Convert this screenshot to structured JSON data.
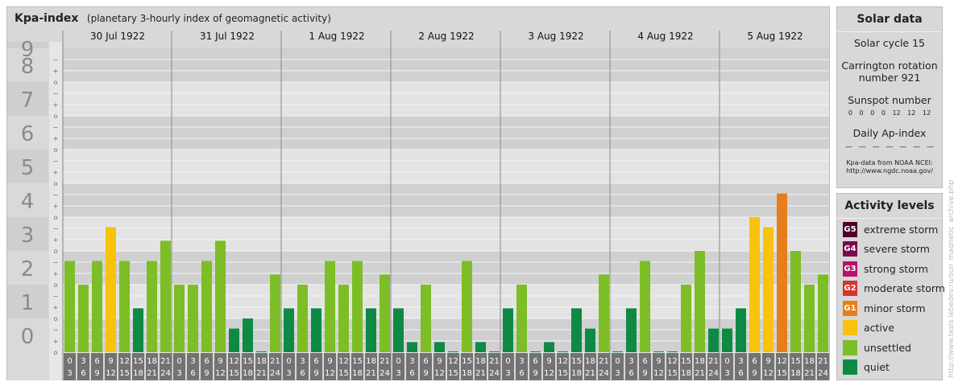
{
  "header": {
    "title": "Kpa-index",
    "subtitle": "(planetary 3-hourly index of geomagnetic activity)"
  },
  "chart_data": {
    "type": "bar",
    "ylim": [
      0,
      9
    ],
    "y_major_ticks": [
      "0",
      "1",
      "2",
      "3",
      "4",
      "5",
      "6",
      "7",
      "8",
      "9"
    ],
    "y_minor_ticks": [
      "o",
      "+",
      "−"
    ],
    "days": [
      "30 Jul 1922",
      "31 Jul 1922",
      "1 Aug 1922",
      "2 Aug 1922",
      "3 Aug 1922",
      "4 Aug 1922",
      "5 Aug 1922"
    ],
    "interval_labels": [
      [
        "0",
        "3"
      ],
      [
        "3",
        "6"
      ],
      [
        "6",
        "9"
      ],
      [
        "9",
        "12"
      ],
      [
        "12",
        "15"
      ],
      [
        "15",
        "18"
      ],
      [
        "18",
        "21"
      ],
      [
        "21",
        "24"
      ]
    ],
    "series": [
      {
        "values": [
          2.7,
          2.0,
          2.7,
          3.7,
          2.7,
          1.3,
          2.7,
          3.3,
          2.0,
          2.0,
          2.7,
          3.3,
          0.7,
          1.0,
          0.0,
          2.3,
          1.3,
          2.0,
          1.3,
          2.7,
          2.0,
          2.7,
          1.3,
          2.3,
          1.3,
          0.3,
          2.0,
          0.3,
          0.0,
          2.7,
          0.3,
          0.0,
          1.3,
          2.0,
          0.0,
          0.3,
          0.0,
          1.3,
          0.7,
          2.3,
          0.0,
          1.3,
          2.7,
          0.0,
          0.0,
          2.0,
          3.0,
          0.7,
          0.7,
          1.3,
          4.0,
          3.7,
          4.7,
          3.0,
          2.0,
          2.3
        ]
      }
    ],
    "colors": {
      "quiet": "#0e8a45",
      "unsettled": "#7dbd26",
      "active": "#f8c20d",
      "minor": "#e87d1c"
    }
  },
  "solar_data": {
    "title": "Solar data",
    "cycle": "Solar cycle 15",
    "carrington_1": "Carrington rotation",
    "carrington_2": "number 921",
    "sunspot_title": "Sunspot number",
    "sunspot_values": "0 0 0 0 12 12 12",
    "ap_title": "Daily Ap-index",
    "ap_values": "— — — — — — —",
    "source_1": "Kpa-data from NOAA NCEI:",
    "source_2": "http://www.ngdc.noaa.gov/"
  },
  "activity_levels": {
    "title": "Activity levels",
    "items": [
      {
        "badge": "G5",
        "label": "extreme storm",
        "color": "#50002a"
      },
      {
        "badge": "G4",
        "label": "severe storm",
        "color": "#7a0a4b"
      },
      {
        "badge": "G3",
        "label": "strong storm",
        "color": "#b7126c"
      },
      {
        "badge": "G2",
        "label": "moderate storm",
        "color": "#d5352f"
      },
      {
        "badge": "G1",
        "label": "minor storm",
        "color": "#e87d1c"
      },
      {
        "badge": "",
        "label": "active",
        "color": "#f8c20d"
      },
      {
        "badge": "",
        "label": "unsettled",
        "color": "#7dbd26"
      },
      {
        "badge": "",
        "label": "quiet",
        "color": "#0e8a45"
      }
    ]
  },
  "watermark": "http://www.tesis.lebedev.ru/sun_magnetic_archive.php"
}
